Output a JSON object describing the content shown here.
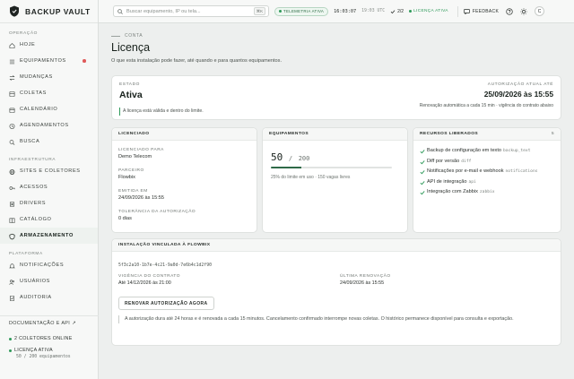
{
  "brand": {
    "name": "BACKUP VAULT"
  },
  "sidebar": {
    "sections": [
      {
        "title": "OPERAÇÃO",
        "items": [
          {
            "label": "HOJE",
            "icon": "home-icon"
          },
          {
            "label": "EQUIPAMENTOS",
            "icon": "list-icon",
            "badge": true
          },
          {
            "label": "MUDANÇAS",
            "icon": "changes-icon"
          },
          {
            "label": "COLETAS",
            "icon": "collections-icon"
          },
          {
            "label": "CALENDÁRIO",
            "icon": "calendar-icon"
          },
          {
            "label": "AGENDAMENTOS",
            "icon": "schedule-icon"
          },
          {
            "label": "BUSCA",
            "icon": "search-icon"
          }
        ]
      },
      {
        "title": "INFRAESTRUTURA",
        "items": [
          {
            "label": "SITES E COLETORES",
            "icon": "sites-icon"
          },
          {
            "label": "ACESSOS",
            "icon": "key-icon"
          },
          {
            "label": "DRIVERS",
            "icon": "drivers-icon"
          },
          {
            "label": "CATÁLOGO",
            "icon": "catalog-icon"
          },
          {
            "label": "ARMAZENAMENTO",
            "icon": "storage-icon",
            "active": true
          }
        ]
      },
      {
        "title": "PLATAFORMA",
        "items": [
          {
            "label": "NOTIFICAÇÕES",
            "icon": "bell-icon"
          },
          {
            "label": "USUÁRIOS",
            "icon": "users-icon"
          },
          {
            "label": "AUDITORIA",
            "icon": "audit-icon"
          }
        ]
      }
    ],
    "footer": {
      "docs_label": "DOCUMENTAÇÃO E API ↗",
      "collectors_online": "2 COLETORES ONLINE",
      "license_active": "LICENÇA ATIVA",
      "license_usage": "50 / 200 equipamentos"
    }
  },
  "topbar": {
    "search_placeholder": "Buscar equipamento, IP ou tela...",
    "shortcut": "⌘K",
    "telemetry": "TELEMETRIA ATIVA",
    "clock": "16:03:07",
    "utc": "19:03 UTC",
    "collectors_ratio": "2/2",
    "license_status": "LICENÇA ATIVA",
    "feedback": "FEEDBACK",
    "avatar_initial": "C"
  },
  "page": {
    "breadcrumb": "CONTA",
    "title": "Licença",
    "subtitle": "O que esta instalação pode fazer, até quando e para quantos equipamentos."
  },
  "status": {
    "label": "ESTADO",
    "value": "Ativa",
    "note": "A licença está válida e dentro do limite.",
    "auth_label": "AUTORIZAÇÃO ATUAL ATÉ",
    "auth_value": "25/09/2026 às 15:55",
    "auth_note": "Renovação automática a cada 15 min · vigência do contrato abaixo"
  },
  "licensed": {
    "header": "LICENCIADO",
    "fields": [
      {
        "k": "LICENCIADO PARA",
        "v": "Demo Telecom"
      },
      {
        "k": "PARCEIRO",
        "v": "Flowbix"
      },
      {
        "k": "EMITIDA EM",
        "v": "24/09/2026 às 15:55"
      },
      {
        "k": "TOLERÂNCIA DA AUTORIZAÇÃO",
        "v": "0 dias"
      }
    ]
  },
  "equipment": {
    "header": "EQUIPAMENTOS",
    "used": "50",
    "sep": "/",
    "limit": "200",
    "fraction": 0.25,
    "note": "25% do limite em uso · 150 vagas livres"
  },
  "resources": {
    "header": "RECURSOS LIBERADOS",
    "count": "5",
    "items": [
      {
        "label": "Backup de configuração em texto",
        "code": "backup_text"
      },
      {
        "label": "Diff por versão",
        "code": "diff"
      },
      {
        "label": "Notificações por e-mail e webhook",
        "code": "notifications"
      },
      {
        "label": "API de integração",
        "code": "api"
      },
      {
        "label": "Integração com Zabbix",
        "code": "zabbix"
      }
    ]
  },
  "flowbix": {
    "header": "INSTALAÇÃO VINCULADA À FLOWBIX",
    "install_id": "5f3c2a10-1b7e-4c21-9a0d-7e6b4c1d2f90",
    "contract_label": "VIGÊNCIA DO CONTRATO",
    "contract_value": "Até 14/12/2026 às 21:00",
    "renewal_label": "ÚLTIMA RENOVAÇÃO",
    "renewal_value": "24/09/2026 às 15:55",
    "renew_button": "RENOVAR AUTORIZAÇÃO AGORA",
    "note": "A autorização dura até 24 horas e é renovada a cada 15 minutos. Cancelamento confirmado interrompe novas coletas. O histórico permanece disponível para consulta e exportação."
  },
  "colors": {
    "accent": "#2f9a5a",
    "bar": "#2f6a48",
    "badge": "#e05a5a"
  }
}
